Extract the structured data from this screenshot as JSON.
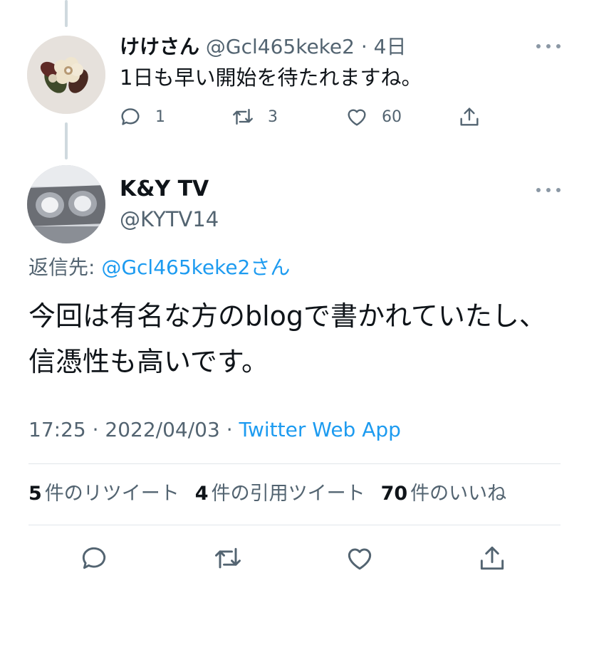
{
  "reply_tweet": {
    "name": "けけさん",
    "handle": "@Gcl465keke2",
    "separator": "·",
    "time_ago": "4日",
    "text": "1日も早い開始を待たれますね。",
    "reply_count": "1",
    "retweet_count": "3",
    "like_count": "60"
  },
  "main_tweet": {
    "name": "K&Y TV",
    "handle": "@KYTV14",
    "reply_to_label": "返信先:",
    "reply_to_mention": "@Gcl465keke2",
    "reply_to_suffix": "さん",
    "text": "今回は有名な方のblogで書かれていたし、信憑性も高いです。",
    "time": "17:25",
    "date": "2022/04/03",
    "meta_separator": "·",
    "source": "Twitter Web App"
  },
  "stats": [
    {
      "count": "5",
      "label": "件のリツイート"
    },
    {
      "count": "4",
      "label": "件の引用ツイート"
    },
    {
      "count": "70",
      "label": "件のいいね"
    }
  ],
  "icons": {
    "reply": "reply-icon",
    "retweet": "retweet-icon",
    "like": "heart-icon",
    "share": "share-icon",
    "more": "more-icon"
  },
  "colors": {
    "link": "#1d9bf0",
    "secondary_text": "#536471",
    "primary_text": "#0f1419"
  }
}
